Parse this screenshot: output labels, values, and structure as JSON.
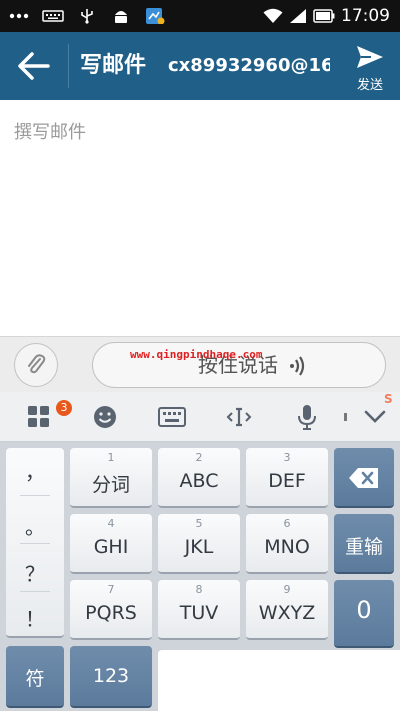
{
  "status_bar": {
    "time": "17:09",
    "icons": [
      "more-icon",
      "keyboard-icon",
      "usb-icon",
      "android-icon",
      "app-notification-icon",
      "wifi-icon",
      "signal-icon",
      "battery-icon"
    ]
  },
  "app_bar": {
    "title": "写邮件",
    "account": "cx89932960@16.",
    "send_label": "发送",
    "color": "#205f87"
  },
  "compose": {
    "placeholder": "撰写邮件"
  },
  "voice_bar": {
    "voice_label": "按住说话",
    "watermark": "www.qingpindhaqe.com"
  },
  "ime_toolbar": {
    "badge_count": "3",
    "s_mark": "S"
  },
  "keyboard": {
    "punctuation": [
      "，",
      "。",
      "？",
      "！"
    ],
    "rows": [
      [
        {
          "num": "1",
          "label": "分词"
        },
        {
          "num": "2",
          "label": "ABC"
        },
        {
          "num": "3",
          "label": "DEF"
        }
      ],
      [
        {
          "num": "4",
          "label": "GHI"
        },
        {
          "num": "5",
          "label": "JKL"
        },
        {
          "num": "6",
          "label": "MNO"
        }
      ],
      [
        {
          "num": "7",
          "label": "PQRS"
        },
        {
          "num": "8",
          "label": "TUV"
        },
        {
          "num": "9",
          "label": "WXYZ"
        }
      ]
    ],
    "reenter_label": "重输",
    "zero_label": "0",
    "symbol_label": "符",
    "numeric_label": "123",
    "dark_key_color": "#6382a3"
  }
}
